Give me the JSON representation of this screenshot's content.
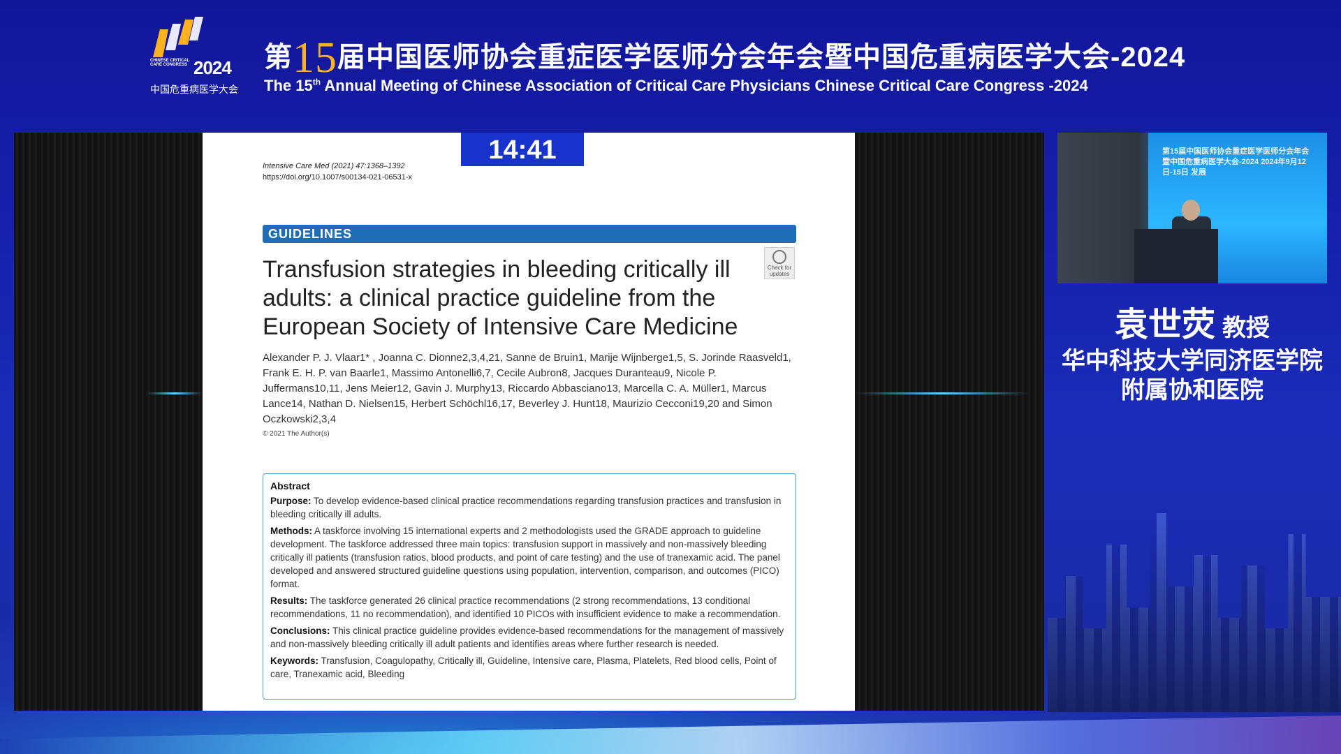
{
  "header": {
    "logo_text": "CHINESE CRITICAL CARE CONGRESS",
    "logo_year": "2024",
    "logo_cn": "中国危重病医学大会",
    "title_cn_prefix": "第",
    "title_cn_number": "15",
    "title_cn_rest": "届中国医师协会重症医学医师分会年会暨中国危重病医学大会-2024",
    "title_en_pre": "The 15",
    "title_en_sup": "th",
    "title_en_post": " Annual Meeting of Chinese Association of Critical Care Physicians Chinese Critical Care Congress -2024"
  },
  "timer": "14:41",
  "paper": {
    "journal": "Intensive Care Med (2021) 47:1368–1392",
    "doi": "https://doi.org/10.1007/s00134-021-06531-x",
    "section": "GUIDELINES",
    "check_updates": "Check for updates",
    "title": "Transfusion strategies in bleeding critically ill adults: a clinical practice guideline from the European Society of Intensive Care Medicine",
    "authors": "Alexander P. J. Vlaar1* , Joanna C. Dionne2,3,4,21, Sanne de Bruin1, Marije Wijnberge1,5, S. Jorinde Raasveld1, Frank E. H. P. van Baarle1, Massimo Antonelli6,7, Cecile Aubron8, Jacques Duranteau9, Nicole P. Juffermans10,11, Jens Meier12, Gavin J. Murphy13, Riccardo Abbasciano13, Marcella C. A. Müller1, Marcus Lance14, Nathan D. Nielsen15, Herbert Schöchl16,17, Beverley J. Hunt18, Maurizio Cecconi19,20 and Simon Oczkowski2,3,4",
    "copyright": "© 2021 The Author(s)",
    "abstract": {
      "heading": "Abstract",
      "purpose_label": "Purpose:",
      "purpose": "To develop evidence-based clinical practice recommendations regarding transfusion practices and transfusion in bleeding critically ill adults.",
      "methods_label": "Methods:",
      "methods": "A taskforce involving 15 international experts and 2 methodologists used the GRADE approach to guideline development. The taskforce addressed three main topics: transfusion support in massively and non-massively bleeding critically ill patients (transfusion ratios, blood products, and point of care testing) and the use of tranexamic acid. The panel developed and answered structured guideline questions using population, intervention, comparison, and outcomes (PICO) format.",
      "results_label": "Results:",
      "results": "The taskforce generated 26 clinical practice recommendations (2 strong recommendations, 13 conditional recommendations, 11 no recommendation), and identified 10 PICOs with insufficient evidence to make a recommendation.",
      "conclusions_label": "Conclusions:",
      "conclusions": "This clinical practice guideline provides evidence-based recommendations for the management of massively and non-massively bleeding critically ill adult patients and identifies areas where further research is needed.",
      "keywords_label": "Keywords:",
      "keywords": "Transfusion, Coagulopathy, Critically ill, Guideline, Intensive care, Plasma, Platelets, Red blood cells, Point of care, Tranexamic acid, Bleeding"
    }
  },
  "speaker": {
    "name": "袁世荧",
    "role": "教授",
    "affiliation_line1": "华中科技大学同济医学院",
    "affiliation_line2": "附属协和医院"
  },
  "video": {
    "screen_text": "第15届中国医师协会重症医学医师分会年会暨中国危重病医学大会-2024 2024年9月12日-15日 发展"
  },
  "colors": {
    "background": "#161ea8",
    "accent_orange": "#ffb21f",
    "timer_blue": "#1733cc",
    "guidelines_blue": "#1f6db5"
  }
}
